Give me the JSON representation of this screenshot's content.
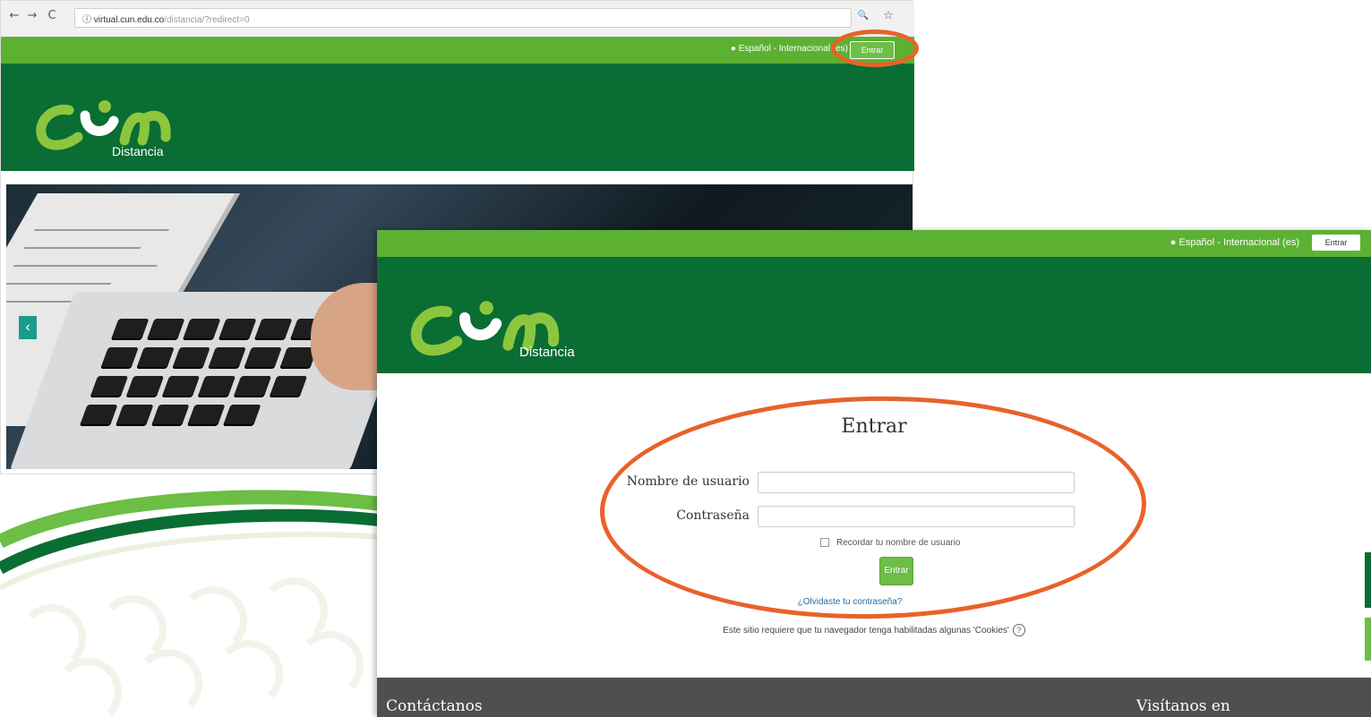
{
  "browser": {
    "url_main": "virtual.cun.edu.co",
    "url_rest": "/distancia/?redirect=0",
    "back_label": "←",
    "forward_label": "→",
    "reload_label": "C",
    "info_label": "ⓘ",
    "zoom_label": "🔍",
    "star_label": "☆"
  },
  "back_page": {
    "language": "Español - Internacional (es)",
    "enter_button": "Entrar",
    "logo_sub": "Distancia",
    "carousel_prev": "‹"
  },
  "front_page": {
    "language": "Español - Internacional (es)",
    "enter_button": "Entrar",
    "logo_sub": "Distancia",
    "login": {
      "title": "Entrar",
      "username_label": "Nombre de usuario",
      "password_label": "Contraseña",
      "remember_label": "Recordar tu nombre de usuario",
      "submit_label": "Entrar",
      "forgot_link": "¿Olvidaste tu contraseña?",
      "cookies_note": "Este sitio requiere que tu navegador tenga habilitadas algunas 'Cookies'",
      "help_icon": "?"
    },
    "footer": {
      "left": "Contáctanos",
      "right": "Visítanos en"
    }
  },
  "colors": {
    "topbar_green": "#5cb133",
    "header_green": "#0a6d33",
    "highlight_orange": "#e8622a",
    "footer_gray": "#4f4f4f"
  }
}
